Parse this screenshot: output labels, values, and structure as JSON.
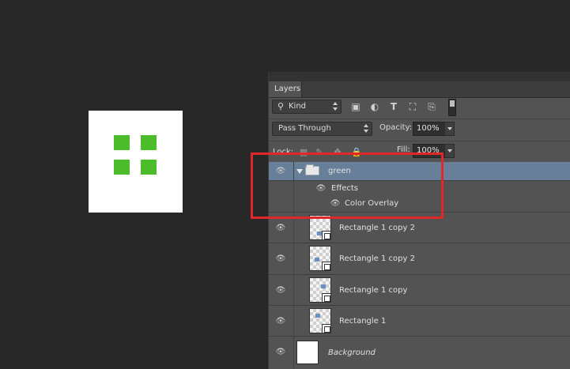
{
  "colors": {
    "accent_green": "#4cbc2b",
    "selection_blue": "#677f99",
    "highlight_red": "#e0272a"
  },
  "panel": {
    "tab_label": "Layers"
  },
  "filter": {
    "kind_label": "Kind",
    "icons": [
      "pixel-filter-icon",
      "adjustment-filter-icon",
      "type-filter-icon",
      "shape-filter-icon",
      "smart-object-filter-icon"
    ]
  },
  "blend": {
    "mode": "Pass Through",
    "opacity_label": "Opacity:",
    "opacity_value": "100%"
  },
  "lock": {
    "label": "Lock:",
    "fill_label": "Fill:",
    "fill_value": "100%"
  },
  "layers": [
    {
      "name": "green",
      "type": "group",
      "expanded": true,
      "selected": true
    },
    {
      "name": "Effects",
      "type": "effects-header"
    },
    {
      "name": "Color Overlay",
      "type": "effect"
    },
    {
      "name": "Rectangle 1 copy 2",
      "type": "shape"
    },
    {
      "name": "Rectangle 1 copy 2",
      "type": "shape"
    },
    {
      "name": "Rectangle 1 copy",
      "type": "shape"
    },
    {
      "name": "Rectangle 1",
      "type": "shape"
    },
    {
      "name": "Background",
      "type": "background"
    }
  ]
}
